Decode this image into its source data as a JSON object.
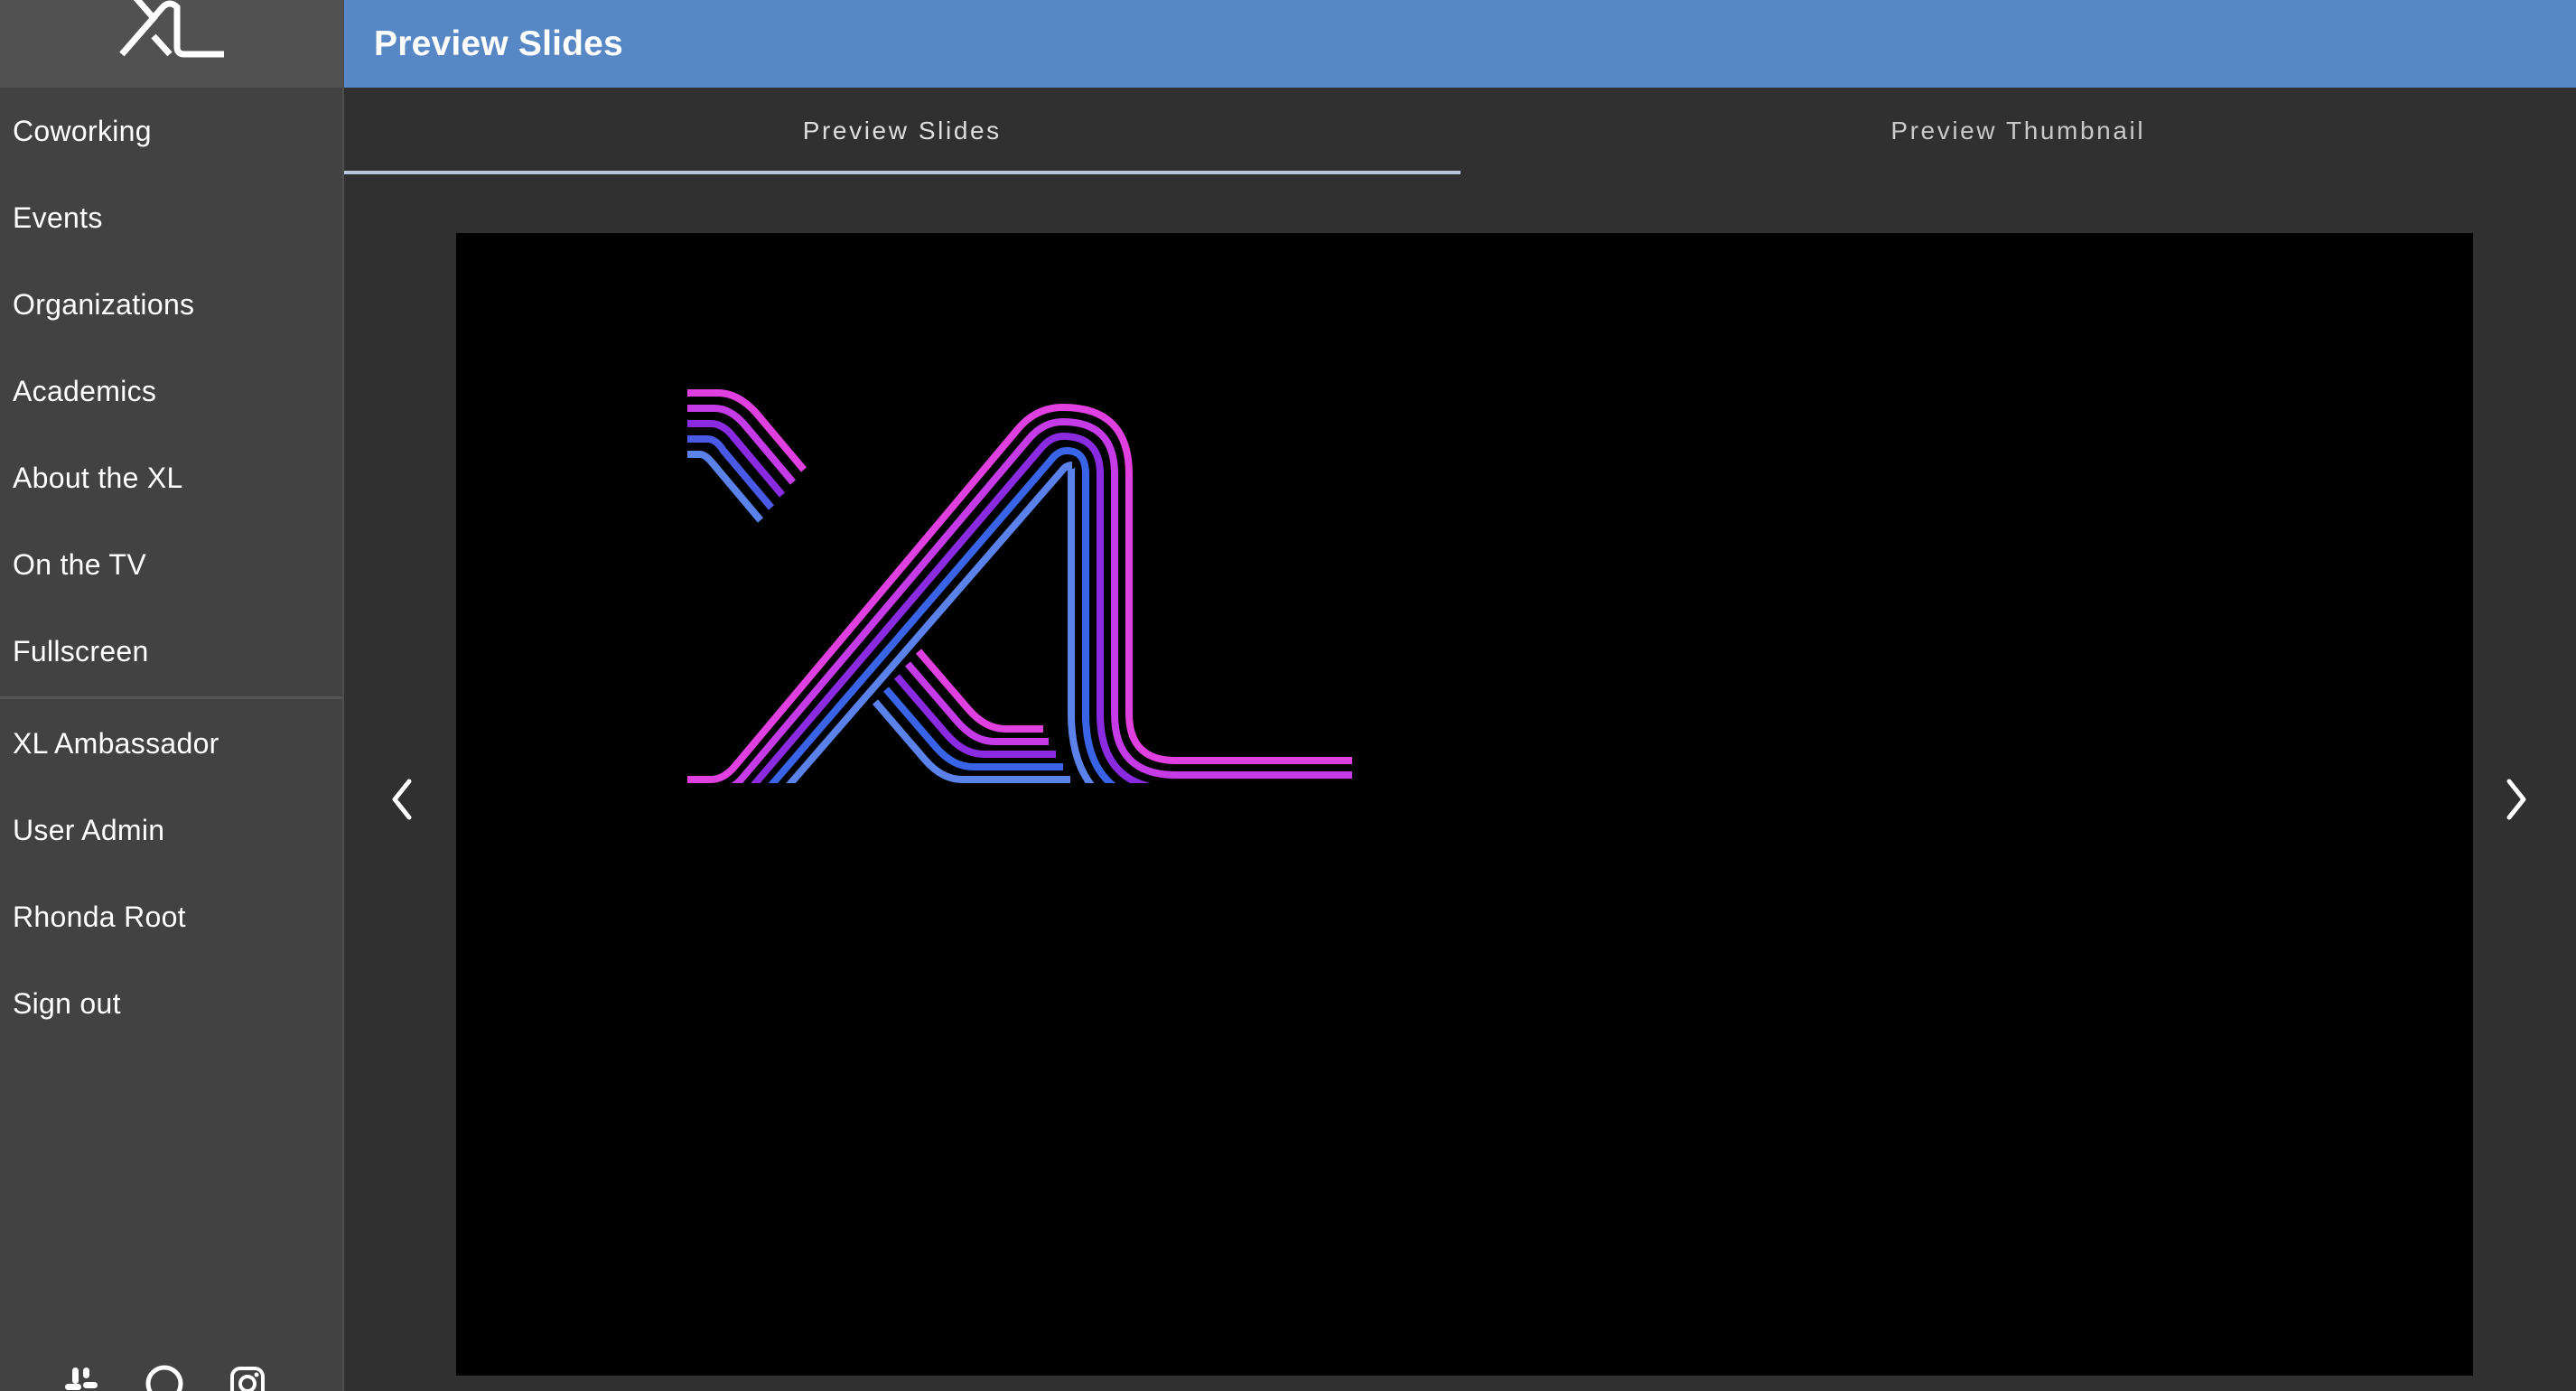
{
  "app": {
    "logo_text": "XL"
  },
  "header": {
    "title": "Preview Slides"
  },
  "sidebar": {
    "items": [
      {
        "label": "Coworking"
      },
      {
        "label": "Events"
      },
      {
        "label": "Organizations"
      },
      {
        "label": "Academics"
      },
      {
        "label": "About the XL"
      },
      {
        "label": "On the TV"
      },
      {
        "label": "Fullscreen"
      }
    ],
    "account_items": [
      {
        "label": "XL Ambassador"
      },
      {
        "label": "User Admin"
      },
      {
        "label": "Rhonda Root"
      },
      {
        "label": "Sign out"
      }
    ],
    "social_icons": [
      "slack-icon",
      "github-icon",
      "instagram-icon"
    ]
  },
  "tabs": [
    {
      "label": "Preview Slides",
      "active": true
    },
    {
      "label": "Preview Thumbnail",
      "active": false
    }
  ],
  "carousel": {
    "prev_icon": "chevron-left-icon",
    "next_icon": "chevron-right-icon",
    "slide_logo": "XL"
  },
  "colors": {
    "appbar": "#5787c4",
    "sidebar": "#424242",
    "background": "#303030",
    "logo_pink": "#e040e0",
    "logo_purple": "#8a2be2",
    "logo_blue": "#3a64e8"
  }
}
